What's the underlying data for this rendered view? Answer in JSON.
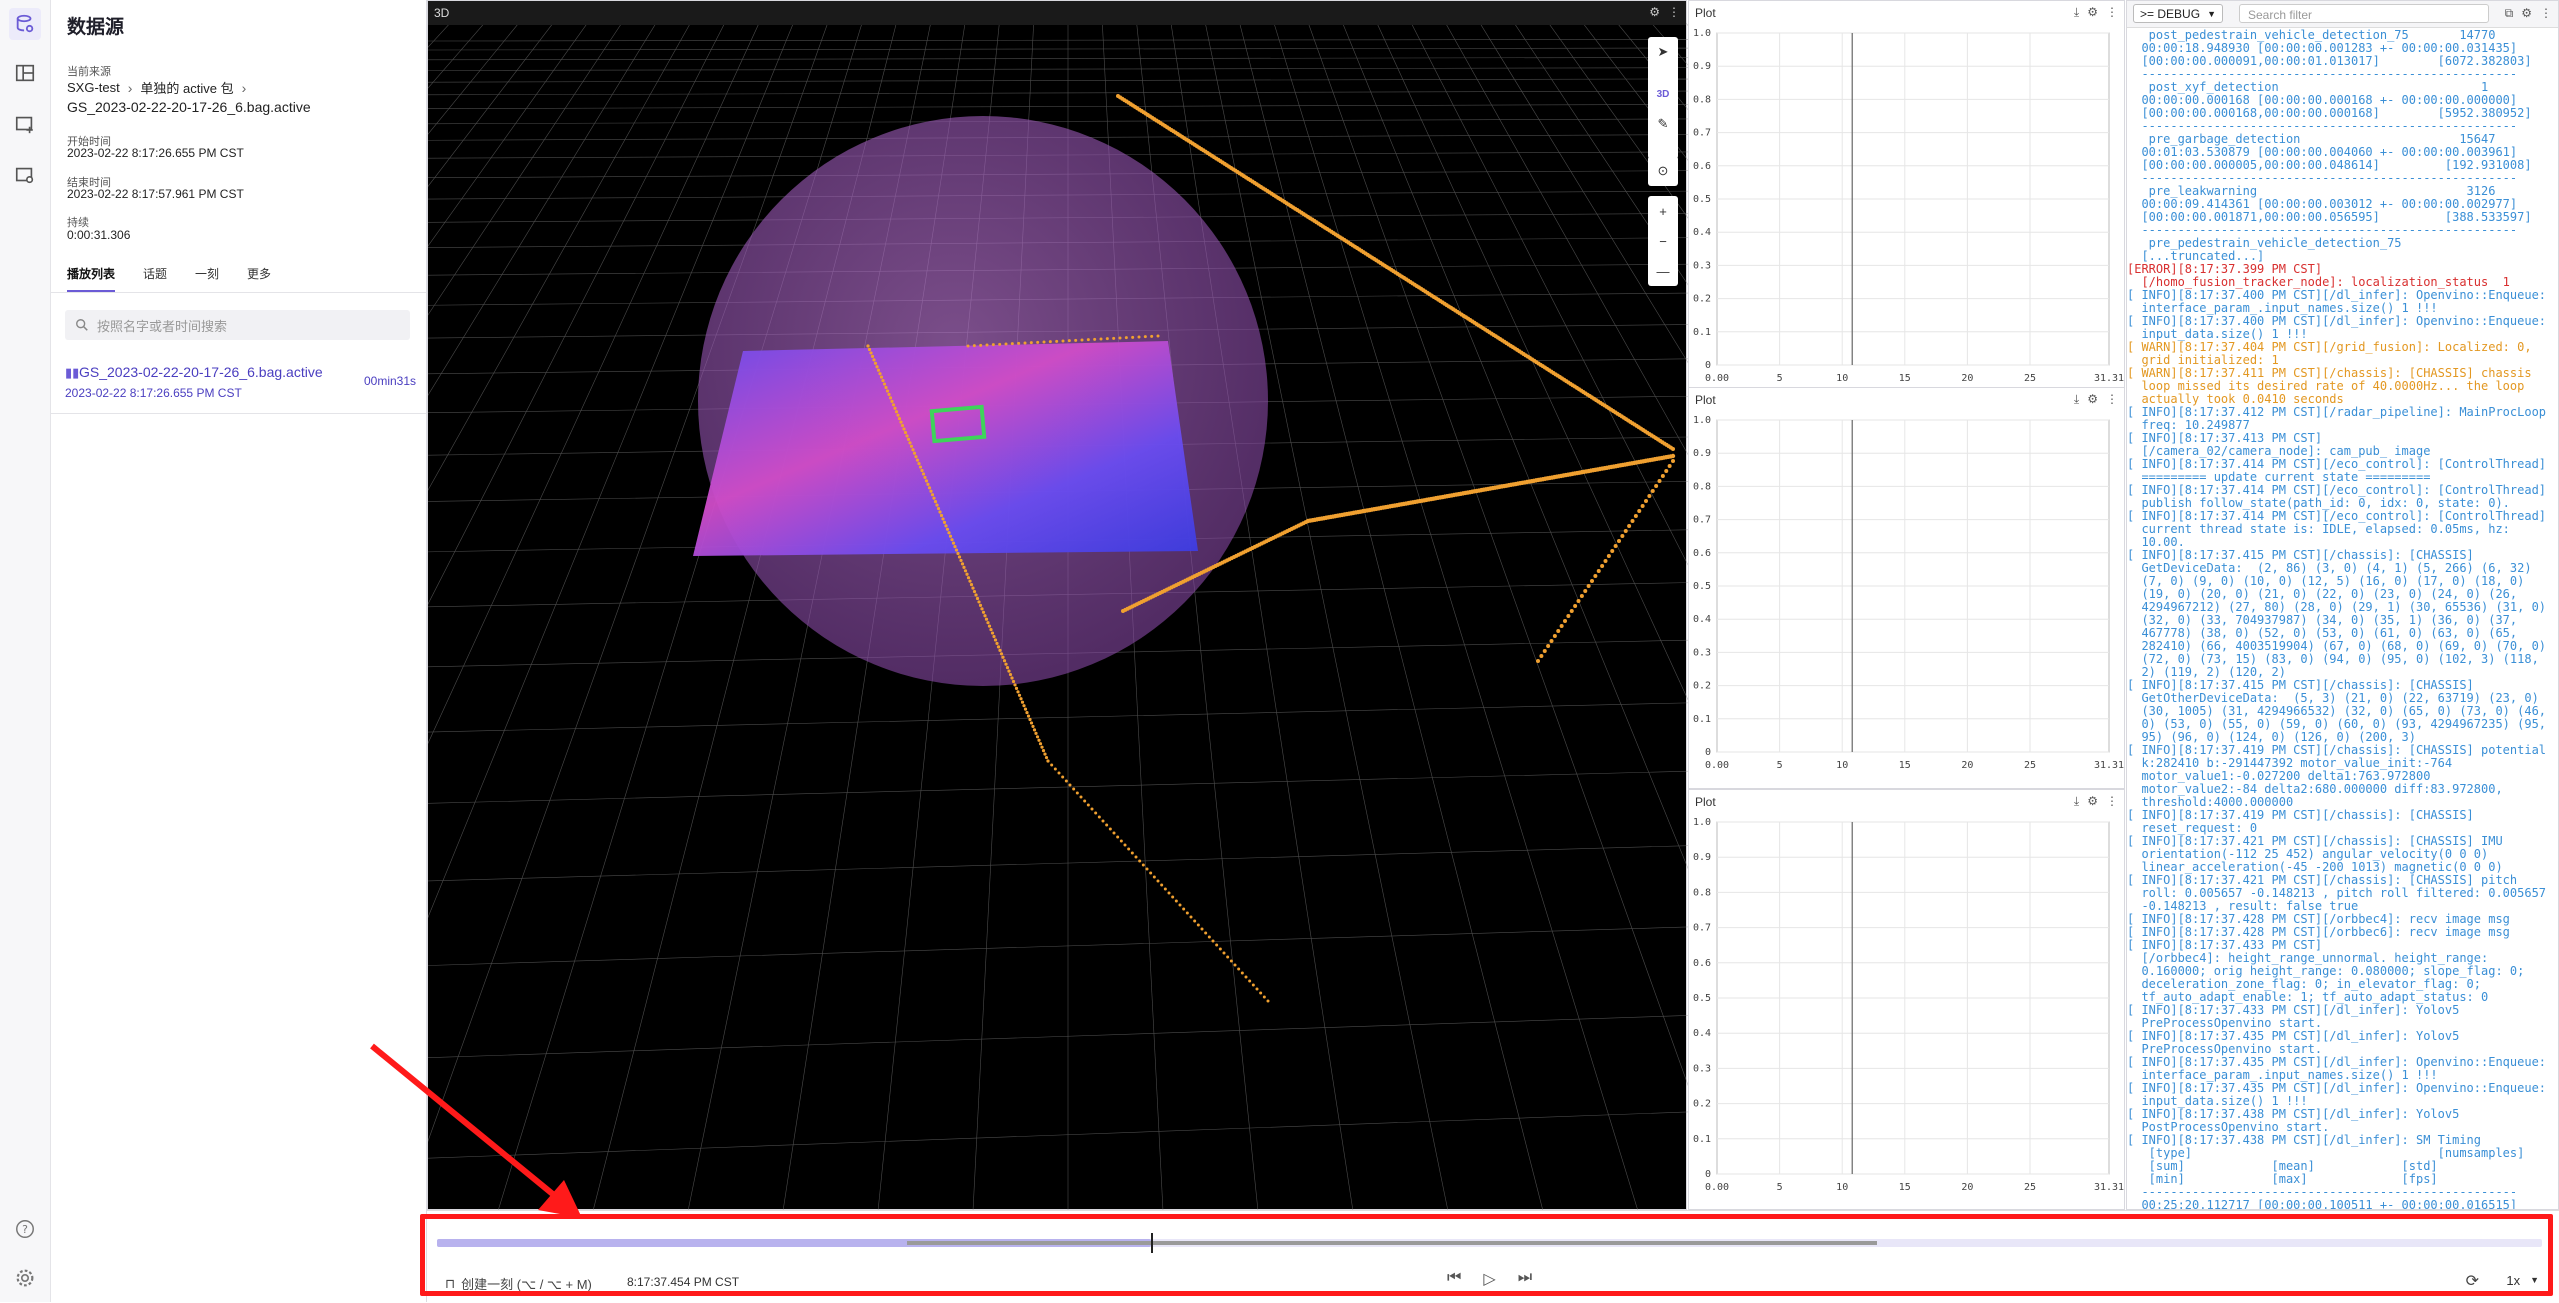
{
  "sidebar": {
    "title": "数据源",
    "current_source_label": "当前来源",
    "breadcrumb": [
      "SXG-test",
      "单独的 active 包"
    ],
    "filename": "GS_2023-02-22-20-17-26_6.bag.active",
    "start_label": "开始时间",
    "start_value": "2023-02-22 8:17:26.655 PM CST",
    "end_label": "结束时间",
    "end_value": "2023-02-22 8:17:57.961 PM CST",
    "duration_label": "持续",
    "duration_value": "0:00:31.306",
    "tabs": [
      "播放列表",
      "话题",
      "一刻",
      "更多"
    ],
    "search_placeholder": "按照名字或者时间搜索",
    "playlist": [
      {
        "name": "GS_2023-02-22-20-17-26_6.bag.active",
        "time": "2023-02-22 8:17:26.655 PM CST",
        "duration": "00min31s"
      }
    ]
  },
  "panel_3d": {
    "title": "3D",
    "tool_3d_label": "3D"
  },
  "plots": [
    {
      "title": "Plot"
    },
    {
      "title": "Plot"
    },
    {
      "title": "Plot"
    }
  ],
  "plot_axis": {
    "y_ticks": [
      "1.0",
      "0.9",
      "0.8",
      "0.7",
      "0.6",
      "0.5",
      "0.4",
      "0.3",
      "0.2",
      "0.1",
      "0"
    ],
    "x_ticks": [
      "0.00",
      "5",
      "10",
      "15",
      "20",
      "25",
      "31.31"
    ]
  },
  "log": {
    "level": ">= DEBUG",
    "filter_placeholder": "Search filter",
    "lines": [
      {
        "t": "stat",
        "s": "   post_pedestrain_vehicle_detection_75       14770"
      },
      {
        "t": "stat",
        "s": "  00:00:18.948930 [00:00:00.001283 +- 00:00:00.031435]"
      },
      {
        "t": "stat",
        "s": "  [00:00:00.000091,00:00:01.013017]        [6072.382803]"
      },
      {
        "t": "stat",
        "s": "  ----------------------------------------------------"
      },
      {
        "t": "stat",
        "s": ""
      },
      {
        "t": "stat",
        "s": "   post_xyf_detection                            1"
      },
      {
        "t": "stat",
        "s": "  00:00:00.000168 [00:00:00.000168 +- 00:00:00.000000]"
      },
      {
        "t": "stat",
        "s": "  [00:00:00.000168,00:00:00.000168]        [5952.380952]"
      },
      {
        "t": "stat",
        "s": "  ----------------------------------------------------"
      },
      {
        "t": "stat",
        "s": ""
      },
      {
        "t": "stat",
        "s": "   pre_garbage_detection                      15647"
      },
      {
        "t": "stat",
        "s": "  00:01:03.530879 [00:00:00.004060 +- 00:00:00.003961]"
      },
      {
        "t": "stat",
        "s": "  [00:00:00.000005,00:00:00.048614]         [192.931008]"
      },
      {
        "t": "stat",
        "s": "  ----------------------------------------------------"
      },
      {
        "t": "stat",
        "s": ""
      },
      {
        "t": "stat",
        "s": "   pre_leakwarning                             3126"
      },
      {
        "t": "stat",
        "s": "  00:00:09.414361 [00:00:00.003012 +- 00:00:00.002977]"
      },
      {
        "t": "stat",
        "s": "  [00:00:00.001871,00:00:00.056595]         [388.533597]"
      },
      {
        "t": "stat",
        "s": "  ----------------------------------------------------"
      },
      {
        "t": "stat",
        "s": ""
      },
      {
        "t": "stat",
        "s": "   pre_pedestrain_vehicle_detection_75"
      },
      {
        "t": "stat",
        "s": "  [...truncated...]"
      },
      {
        "t": "err",
        "s": "[ERROR][8:17:37.399 PM CST]"
      },
      {
        "t": "err",
        "s": "  [/homo_fusion_tracker_node]: localization_status  1"
      },
      {
        "t": "info",
        "s": "[ INFO][8:17:37.400 PM CST][/dl_infer]: Openvino::Enqueue:"
      },
      {
        "t": "info",
        "s": "  interface_param_.input_names.size() 1 !!!"
      },
      {
        "t": "info",
        "s": "[ INFO][8:17:37.400 PM CST][/dl_infer]: Openvino::Enqueue:"
      },
      {
        "t": "info",
        "s": "  input_data.size() 1 !!!"
      },
      {
        "t": "warn",
        "s": "[ WARN][8:17:37.404 PM CST][/grid_fusion]: Localized: 0,"
      },
      {
        "t": "warn",
        "s": "  grid initialized: 1"
      },
      {
        "t": "warn",
        "s": "[ WARN][8:17:37.411 PM CST][/chassis]: [CHASSIS] chassis"
      },
      {
        "t": "warn",
        "s": "  loop missed its desired rate of 40.0000Hz... the loop"
      },
      {
        "t": "warn",
        "s": "  actually took 0.0410 seconds"
      },
      {
        "t": "info",
        "s": "[ INFO][8:17:37.412 PM CST][/radar_pipeline]: MainProcLoop"
      },
      {
        "t": "info",
        "s": "  freq: 10.249877"
      },
      {
        "t": "info",
        "s": "[ INFO][8:17:37.413 PM CST]"
      },
      {
        "t": "info",
        "s": "  [/camera_02/camera_node]: cam_pub_ image"
      },
      {
        "t": "info",
        "s": "[ INFO][8:17:37.414 PM CST][/eco_control]: [ControlThread]"
      },
      {
        "t": "info",
        "s": "  ========= update current state ========="
      },
      {
        "t": "info",
        "s": "[ INFO][8:17:37.414 PM CST][/eco_control]: [ControlThread]"
      },
      {
        "t": "info",
        "s": "  publish follow_state(path_id: 0, idx: 0, state: 0)."
      },
      {
        "t": "info",
        "s": "[ INFO][8:17:37.414 PM CST][/eco_control]: [ControlThread]"
      },
      {
        "t": "info",
        "s": "  current thread state is: IDLE, elapsed: 0.05ms, hz:"
      },
      {
        "t": "info",
        "s": "  10.00."
      },
      {
        "t": "info",
        "s": "[ INFO][8:17:37.415 PM CST][/chassis]: [CHASSIS]"
      },
      {
        "t": "info",
        "s": "  GetDeviceData:  (2, 86) (3, 0) (4, 1) (5, 266) (6, 32)"
      },
      {
        "t": "info",
        "s": "  (7, 0) (9, 0) (10, 0) (12, 5) (16, 0) (17, 0) (18, 0)"
      },
      {
        "t": "info",
        "s": "  (19, 0) (20, 0) (21, 0) (22, 0) (23, 0) (24, 0) (26,"
      },
      {
        "t": "info",
        "s": "  4294967212) (27, 80) (28, 0) (29, 1) (30, 65536) (31, 0)"
      },
      {
        "t": "info",
        "s": "  (32, 0) (33, 704937987) (34, 0) (35, 1) (36, 0) (37,"
      },
      {
        "t": "info",
        "s": "  467778) (38, 0) (52, 0) (53, 0) (61, 0) (63, 0) (65,"
      },
      {
        "t": "info",
        "s": "  282410) (66, 4003519904) (67, 0) (68, 0) (69, 0) (70, 0)"
      },
      {
        "t": "info",
        "s": "  (72, 0) (73, 15) (83, 0) (94, 0) (95, 0) (102, 3) (118,"
      },
      {
        "t": "info",
        "s": "  2) (119, 2) (120, 2)"
      },
      {
        "t": "info",
        "s": "[ INFO][8:17:37.415 PM CST][/chassis]: [CHASSIS]"
      },
      {
        "t": "info",
        "s": "  GetOtherDeviceData:  (5, 3) (21, 0) (22, 63719) (23, 0)"
      },
      {
        "t": "info",
        "s": "  (30, 1005) (31, 4294966532) (32, 0) (65, 0) (73, 0) (46,"
      },
      {
        "t": "info",
        "s": "  0) (53, 0) (55, 0) (59, 0) (60, 0) (93, 4294967235) (95,"
      },
      {
        "t": "info",
        "s": "  95) (96, 0) (124, 0) (126, 0) (200, 3)"
      },
      {
        "t": "info",
        "s": "[ INFO][8:17:37.419 PM CST][/chassis]: [CHASSIS] potential"
      },
      {
        "t": "info",
        "s": "  k:282410 b:-291447392 motor_value_init:-764"
      },
      {
        "t": "info",
        "s": "  motor_value1:-0.027200 delta1:763.972800"
      },
      {
        "t": "info",
        "s": "  motor_value2:-84 delta2:680.000000 diff:83.972800,"
      },
      {
        "t": "info",
        "s": "  threshold:4000.000000"
      },
      {
        "t": "info",
        "s": "[ INFO][8:17:37.419 PM CST][/chassis]: [CHASSIS]"
      },
      {
        "t": "info",
        "s": "  reset_request: 0"
      },
      {
        "t": "info",
        "s": "[ INFO][8:17:37.421 PM CST][/chassis]: [CHASSIS] IMU"
      },
      {
        "t": "info",
        "s": "  orientation(-112 25 452) angular_velocity(0 0 0)"
      },
      {
        "t": "info",
        "s": "  linear_acceleration(-45 -200 1013) magnetic(0 0 0)"
      },
      {
        "t": "info",
        "s": "[ INFO][8:17:37.421 PM CST][/chassis]: [CHASSIS] pitch"
      },
      {
        "t": "info",
        "s": "  roll: 0.005657 -0.148213 , pitch roll filtered: 0.005657"
      },
      {
        "t": "info",
        "s": "  -0.148213 , result: false true"
      },
      {
        "t": "info",
        "s": "[ INFO][8:17:37.428 PM CST][/orbbec4]: recv image msg"
      },
      {
        "t": "info",
        "s": "[ INFO][8:17:37.428 PM CST][/orbbec6]: recv image msg"
      },
      {
        "t": "info",
        "s": "[ INFO][8:17:37.433 PM CST]"
      },
      {
        "t": "info",
        "s": "  [/orbbec4]: height_range_unnormal. height_range:"
      },
      {
        "t": "info",
        "s": "  0.160000; orig height_range: 0.080000; slope_flag: 0;"
      },
      {
        "t": "info",
        "s": "  deceleration_zone_flag: 0; in_elevator_flag: 0;"
      },
      {
        "t": "info",
        "s": "  tf_auto_adapt_enable: 1; tf_auto_adapt_status: 0"
      },
      {
        "t": "info",
        "s": "[ INFO][8:17:37.433 PM CST][/dl_infer]: Yolov5"
      },
      {
        "t": "info",
        "s": "  PreProcessOpenvino start."
      },
      {
        "t": "info",
        "s": "[ INFO][8:17:37.435 PM CST][/dl_infer]: Yolov5"
      },
      {
        "t": "info",
        "s": "  PreProcessOpenvino start."
      },
      {
        "t": "info",
        "s": "[ INFO][8:17:37.435 PM CST][/dl_infer]: Openvino::Enqueue:"
      },
      {
        "t": "info",
        "s": "  interface_param_.input_names.size() 1 !!!"
      },
      {
        "t": "info",
        "s": "[ INFO][8:17:37.435 PM CST][/dl_infer]: Openvino::Enqueue:"
      },
      {
        "t": "info",
        "s": "  input_data.size() 1 !!!"
      },
      {
        "t": "info",
        "s": "[ INFO][8:17:37.438 PM CST][/dl_infer]: Yolov5"
      },
      {
        "t": "info",
        "s": "  PostProcessOpenvino start."
      },
      {
        "t": "info",
        "s": "[ INFO][8:17:37.438 PM CST][/dl_infer]: SM Timing"
      },
      {
        "t": "info",
        "s": "   [type]                                  [numsamples]"
      },
      {
        "t": "info",
        "s": "   [sum]            [mean]            [std]"
      },
      {
        "t": "info",
        "s": "   [min]            [max]             [fps]"
      },
      {
        "t": "info",
        "s": "  ----------------------------------------------------"
      },
      {
        "t": "info",
        "s": ""
      },
      {
        "t": "info",
        "s": "  00:25:20.112717 [00:00:00.100511 +- 00:00:00.016515]"
      }
    ]
  },
  "playback": {
    "moment_label": "创建一刻 (⌥ / ⌥ + M)",
    "current_time": "8:17:37.454 PM CST",
    "speed": "1x",
    "progress": 0.339
  },
  "colors": {
    "accent": "#6b5bd6",
    "highlight": "#ff1a1a",
    "pointcloud": "#f0a030"
  }
}
